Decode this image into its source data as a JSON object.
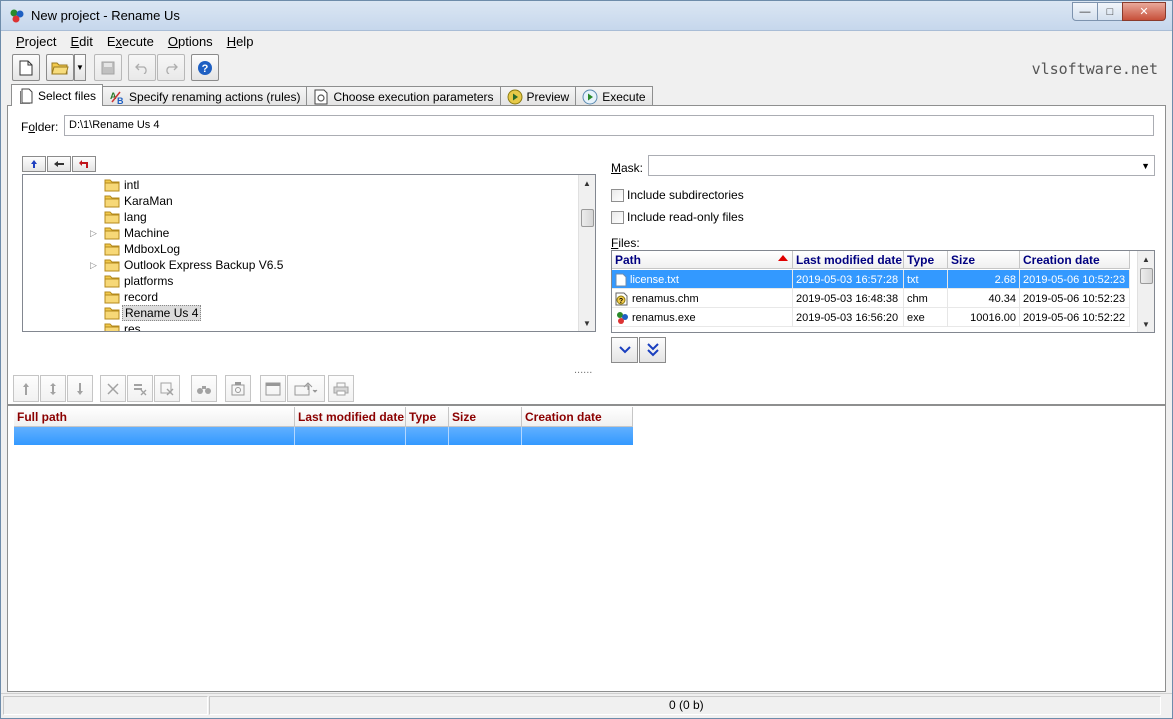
{
  "window": {
    "title": "New project - Rename Us",
    "min_glyph": "—",
    "max_glyph": "□",
    "close_glyph": "✕"
  },
  "menu": [
    {
      "label": "Project",
      "key": "P",
      "rest": "roject"
    },
    {
      "label": "Edit",
      "key": "E",
      "rest": "dit"
    },
    {
      "label": "Execute",
      "key": "x",
      "pre": "E",
      "rest": "ecute"
    },
    {
      "label": "Options",
      "key": "O",
      "rest": "ptions"
    },
    {
      "label": "Help",
      "key": "H",
      "rest": "elp"
    }
  ],
  "brand": "vlsoftware.net",
  "tabs": [
    {
      "label": "Select files",
      "icon": "select-files-icon",
      "active": true
    },
    {
      "label": "Specify renaming actions (rules)",
      "icon": "rules-icon"
    },
    {
      "label": "Choose execution parameters",
      "icon": "parameters-icon"
    },
    {
      "label": "Preview",
      "icon": "preview-icon"
    },
    {
      "label": "Execute",
      "icon": "execute-icon"
    }
  ],
  "folder": {
    "label_pre": "F",
    "label_key": "o",
    "label_rest": "lder:",
    "value": "D:\\1\\Rename Us 4"
  },
  "tree": [
    {
      "label": "intl",
      "expandable": false
    },
    {
      "label": "KaraMan",
      "expandable": false
    },
    {
      "label": "lang",
      "expandable": false
    },
    {
      "label": "Machine",
      "expandable": true
    },
    {
      "label": "MdboxLog",
      "expandable": false
    },
    {
      "label": "Outlook Express Backup V6.5",
      "expandable": true
    },
    {
      "label": "platforms",
      "expandable": false
    },
    {
      "label": "record",
      "expandable": false
    },
    {
      "label": "Rename Us 4",
      "expandable": false,
      "selected": true
    },
    {
      "label": "res",
      "expandable": false
    }
  ],
  "mask": {
    "label_key": "M",
    "label_rest": "ask:",
    "value": ""
  },
  "checkboxes": {
    "subdirs": "Include subdirectories",
    "readonly": "Include read-only files"
  },
  "files": {
    "label_key": "F",
    "label_rest": "iles:",
    "columns": [
      "Path",
      "Last modified date",
      "Type",
      "Size",
      "Creation date"
    ],
    "rows": [
      {
        "path": "license.txt",
        "modified": "2019-05-03 16:57:28",
        "type": "txt",
        "size": "2.68",
        "created": "2019-05-06 10:52:23",
        "icon": "text-file-icon",
        "selected": true
      },
      {
        "path": "renamus.chm",
        "modified": "2019-05-03 16:48:38",
        "type": "chm",
        "size": "40.34",
        "created": "2019-05-06 10:52:23",
        "icon": "help-file-icon"
      },
      {
        "path": "renamus.exe",
        "modified": "2019-05-03 16:56:20",
        "type": "exe",
        "size": "10016.00",
        "created": "2019-05-06 10:52:22",
        "icon": "exe-file-icon"
      }
    ]
  },
  "splitter": "......",
  "lower_grid": {
    "columns": [
      "Full path",
      "Last modified date",
      "Type",
      "Size",
      "Creation date"
    ]
  },
  "status": {
    "count_text": "0   (0 b)"
  },
  "colors": {
    "selection": "#3399ff",
    "header_blue": "#000080",
    "header_red": "#8b0000"
  }
}
